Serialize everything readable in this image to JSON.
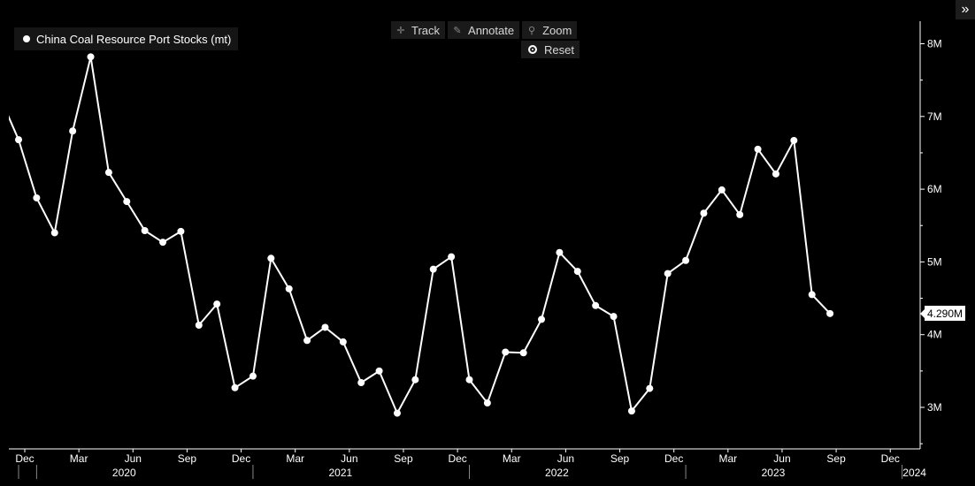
{
  "legend": {
    "label": "China Coal Resource Port Stocks (mt)"
  },
  "toolbar": {
    "track_label": "Track",
    "annotate_label": "Annotate",
    "zoom_label": "Zoom",
    "reset_label": "Reset",
    "track_icon": "crosshair-icon",
    "annotate_icon": "pencil-icon",
    "zoom_icon": "magnifier-icon",
    "reset_icon": "radio-icon",
    "expand_icon": "double-chevron-right-icon"
  },
  "last_value_label": "4.290M",
  "colors": {
    "background": "#000000",
    "line": "#ffffff",
    "axis": "#ffffff"
  },
  "chart_data": {
    "type": "line",
    "title": "",
    "xlabel": "",
    "ylabel": "",
    "ylim": [
      2.5,
      8.3
    ],
    "y_ticks": [
      3,
      4,
      5,
      6,
      7,
      8
    ],
    "y_tick_labels": [
      "3M",
      "4M",
      "5M",
      "6M",
      "7M",
      "8M"
    ],
    "x_month_ticks": [
      "Dec",
      "Mar",
      "Jun",
      "Sep",
      "Dec",
      "Mar",
      "Jun",
      "Sep",
      "Dec",
      "Mar",
      "Jun",
      "Sep",
      "Dec",
      "Mar",
      "Jun",
      "Sep",
      "Dec"
    ],
    "x_year_labels": [
      "2020",
      "2021",
      "2022",
      "2023",
      "2024"
    ],
    "grid": false,
    "legend_position": "top-left",
    "series": [
      {
        "name": "China Coal Resource Port Stocks (mt)",
        "x": [
          "2019-11",
          "2019-12",
          "2020-01",
          "2020-02",
          "2020-03",
          "2020-04",
          "2020-05",
          "2020-06",
          "2020-07",
          "2020-08",
          "2020-09",
          "2020-10",
          "2020-11",
          "2020-12",
          "2021-01",
          "2021-02",
          "2021-03",
          "2021-04",
          "2021-05",
          "2021-06",
          "2021-07",
          "2021-08",
          "2021-09",
          "2021-10",
          "2021-11",
          "2021-12",
          "2022-01",
          "2022-02",
          "2022-03",
          "2022-04",
          "2022-05",
          "2022-06",
          "2022-07",
          "2022-08",
          "2022-09",
          "2022-10",
          "2022-11",
          "2022-12",
          "2023-01",
          "2023-02",
          "2023-03",
          "2023-04",
          "2023-05",
          "2023-06",
          "2023-07",
          "2023-08",
          "2023-09"
        ],
        "values": [
          7.25,
          6.68,
          5.88,
          5.4,
          6.8,
          7.82,
          6.23,
          5.83,
          5.43,
          5.27,
          5.42,
          4.13,
          4.42,
          3.27,
          3.43,
          5.05,
          4.63,
          3.92,
          4.1,
          3.9,
          3.34,
          3.5,
          2.92,
          3.38,
          4.9,
          5.07,
          3.38,
          3.06,
          3.76,
          3.75,
          4.21,
          5.13,
          4.87,
          4.4,
          4.25,
          2.95,
          3.26,
          4.84,
          5.02,
          5.67,
          5.99,
          5.65,
          6.55,
          6.21,
          6.67,
          4.55,
          4.29
        ],
        "markers": "circle"
      }
    ]
  }
}
